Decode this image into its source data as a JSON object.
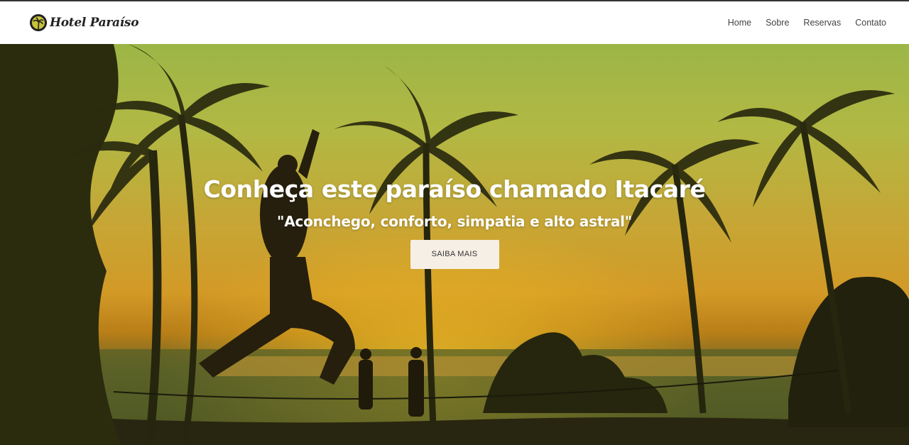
{
  "header": {
    "brand_name": "Hotel Paraíso",
    "nav": [
      {
        "label": "Home"
      },
      {
        "label": "Sobre"
      },
      {
        "label": "Reservas"
      },
      {
        "label": "Contato"
      }
    ]
  },
  "hero": {
    "title": "Conheça este paraíso chamado Itacaré",
    "subtitle": "\"Aconchego, conforto, simpatia e alto astral\"",
    "button_label": "SAIBA MAIS"
  },
  "colors": {
    "navbar_bg": "#ffffff",
    "nav_text": "#444444",
    "hero_text": "#ffffff",
    "button_bg": "#f6efe6"
  }
}
